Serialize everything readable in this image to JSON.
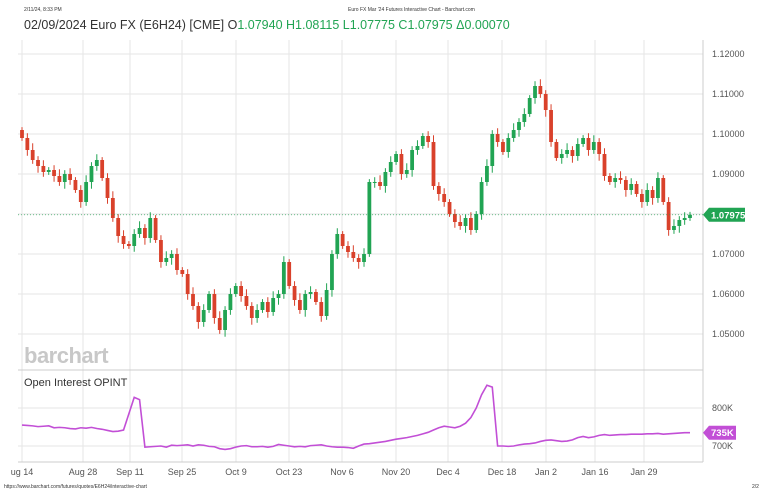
{
  "browser": {
    "timestamp": "2/11/24, 8:33 PM",
    "page_title": "Euro FX Mar '24 Futures Interactive Chart - Barchart.com",
    "url": "https://www.barchart.com/futures/quotes/E6H24/interactive-chart",
    "page_num": "2/2"
  },
  "header": {
    "date": "02/09/2024",
    "symbol": "Euro FX (E6H24) [CME]",
    "open_label": "O",
    "open": "1.07940",
    "high": "H1.08115",
    "low": "L1.07775",
    "close": "C1.07975",
    "change": "Δ0.00070"
  },
  "watermark": "barchart",
  "colors": {
    "up": "#21a453",
    "down": "#d9412b",
    "oi": "#c24fd6",
    "grid": "#e6e6e6"
  },
  "chart_data": [
    {
      "type": "candlestick",
      "title": "Euro FX (E6H24) [CME]",
      "ylim": [
        1.045,
        1.125
      ],
      "yticks": [
        "1.12000",
        "1.11000",
        "1.10000",
        "1.09000",
        "1.08000",
        "1.07000",
        "1.06000",
        "1.05000"
      ],
      "last_price_label": "1.07975",
      "first_open": 1.101,
      "wick": 0.0012,
      "close": [
        1.099,
        1.096,
        1.0935,
        1.092,
        1.0905,
        1.091,
        1.0895,
        1.088,
        1.09,
        1.0885,
        1.086,
        1.083,
        1.088,
        1.092,
        1.0935,
        1.089,
        1.084,
        1.079,
        1.0745,
        1.0725,
        1.072,
        1.075,
        1.0765,
        1.074,
        1.079,
        1.0735,
        1.068,
        1.069,
        1.07,
        1.066,
        1.065,
        1.06,
        1.057,
        1.053,
        1.056,
        1.06,
        1.054,
        1.051,
        1.056,
        1.06,
        1.062,
        1.0595,
        1.057,
        1.054,
        1.056,
        1.058,
        1.0555,
        1.059,
        1.06,
        1.068,
        1.062,
        1.0585,
        1.056,
        1.06,
        1.0605,
        1.058,
        1.0545,
        1.061,
        1.07,
        1.075,
        1.072,
        1.0705,
        1.069,
        1.068,
        1.07,
        1.088,
        1.088,
        1.087,
        1.0905,
        1.093,
        1.095,
        1.09,
        1.091,
        1.096,
        1.097,
        1.0995,
        1.098,
        1.087,
        1.085,
        1.083,
        1.08,
        1.078,
        1.077,
        1.079,
        1.076,
        1.08,
        1.088,
        1.092,
        1.1,
        1.098,
        1.0955,
        1.099,
        1.101,
        1.103,
        1.105,
        1.109,
        1.112,
        1.11,
        1.106,
        1.098,
        1.094,
        1.095,
        1.096,
        1.0945,
        1.0975,
        1.099,
        1.096,
        1.098,
        1.095,
        1.0895,
        1.088,
        1.089,
        1.0885,
        1.086,
        1.0875,
        1.085,
        1.083,
        1.086,
        1.084,
        1.089,
        1.083,
        1.076,
        1.077,
        1.0785,
        1.079,
        1.0798
      ]
    },
    {
      "type": "line",
      "title": "Open Interest OPINT",
      "ylim": [
        680,
        870
      ],
      "yticks": [
        "800K",
        "700K"
      ],
      "last_value_label": "735K",
      "values": [
        755,
        754,
        753,
        751,
        752,
        753,
        748,
        749,
        748,
        746,
        745,
        748,
        747,
        749,
        746,
        744,
        741,
        738,
        739,
        742,
        785,
        828,
        822,
        697,
        698,
        699,
        700,
        697,
        702,
        701,
        702,
        703,
        700,
        703,
        702,
        699,
        698,
        693,
        691,
        693,
        697,
        700,
        701,
        698,
        698,
        699,
        697,
        699,
        704,
        702,
        700,
        698,
        699,
        698,
        701,
        702,
        703,
        700,
        698,
        697,
        697,
        696,
        694,
        700,
        705,
        706,
        708,
        710,
        712,
        715,
        718,
        720,
        722,
        725,
        728,
        732,
        736,
        742,
        748,
        752,
        750,
        748,
        752,
        760,
        775,
        800,
        835,
        860,
        855,
        700,
        700,
        699,
        700,
        703,
        705,
        706,
        708,
        712,
        715,
        716,
        714,
        712,
        713,
        716,
        722,
        725,
        722,
        724,
        728,
        730,
        728,
        729,
        730,
        730,
        731,
        731,
        731,
        732,
        732,
        733,
        731,
        732,
        733,
        734,
        735,
        735
      ]
    },
    {
      "type": "x-axis",
      "labels": [
        "ug 14",
        "Aug 28",
        "Sep 11",
        "Sep 25",
        "Oct 9",
        "Oct 23",
        "Nov 6",
        "Nov 20",
        "Dec 4",
        "Dec 18",
        "Jan 2",
        "Jan 16",
        "Jan 29"
      ]
    }
  ]
}
